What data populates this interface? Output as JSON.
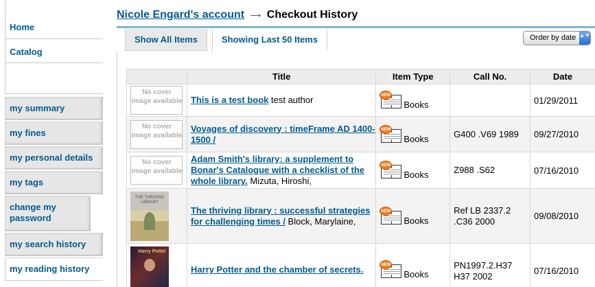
{
  "sidebar": {
    "home_label": "Home",
    "catalog_label": "Catalog",
    "items": [
      {
        "label": "my summary",
        "active": false
      },
      {
        "label": "my fines",
        "active": false
      },
      {
        "label": "my personal details",
        "active": false
      },
      {
        "label": "my tags",
        "active": false
      },
      {
        "label": "change my password",
        "active": false
      },
      {
        "label": "my search history",
        "active": false
      },
      {
        "label": "my reading history",
        "active": true
      }
    ]
  },
  "header": {
    "account_link": "Nicole Engard's account",
    "separator": "⟶",
    "current_page": "Checkout History"
  },
  "tabs": [
    {
      "label": "Show All Items",
      "active": false
    },
    {
      "label": "Showing Last 50 Items",
      "active": true
    }
  ],
  "order_select": {
    "value": "Order by date",
    "chevron": "▲▼"
  },
  "table": {
    "columns": [
      "",
      "Title",
      "Item Type",
      "Call No.",
      "Date"
    ],
    "no_cover_text": "No cover image available",
    "rows": [
      {
        "cover": "none",
        "title": "This is a test book",
        "author": "test author",
        "item_type": "Books",
        "call_no": "",
        "date": "01/29/2011"
      },
      {
        "cover": "none",
        "title": "Voyages of discovery : timeFrame AD 1400-1500 /",
        "author": "",
        "item_type": "Books",
        "call_no": "G400 .V69 1989",
        "date": "09/27/2010"
      },
      {
        "cover": "none",
        "title": "Adam Smith's library: a supplement to Bonar's Catalogue with a checklist of the whole library.",
        "author": "Mizuta, Hiroshi,",
        "item_type": "Books",
        "call_no": "Z988 .S62",
        "date": "07/16/2010"
      },
      {
        "cover": "thriving",
        "title": "The thriving library : successful strategies for challenging times /",
        "author": "Block, Marylaine,",
        "item_type": "Books",
        "call_no": "Ref LB 2337.2 .C36 2000",
        "date": "09/08/2010"
      },
      {
        "cover": "hp",
        "title": "Harry Potter and the chamber of secrets.",
        "author": "",
        "item_type": "Books",
        "call_no": "PN1997.2.H37 H37 2002",
        "date": "07/16/2010"
      }
    ]
  },
  "covers": {
    "thriving_text": "THE THRIVING LIBRARY",
    "hp_text": "Harry Potter"
  },
  "icons": {
    "book": "book-icon",
    "new_badge": "NEW"
  },
  "colors": {
    "link": "#005b8f",
    "rule": "#7cb7c8",
    "tab_inactive": "#e9e9e9",
    "sidebar_item": "#e6e6e6"
  }
}
